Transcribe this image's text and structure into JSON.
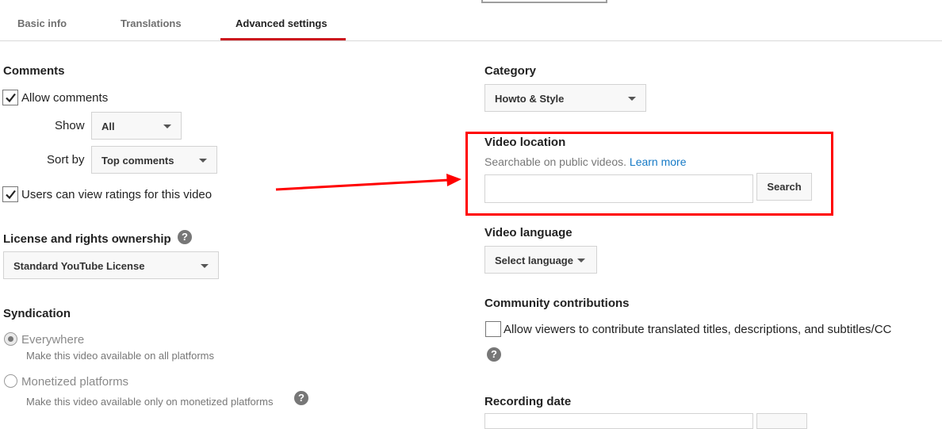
{
  "tabs": [
    "Basic info",
    "Translations",
    "Advanced settings"
  ],
  "comments": {
    "title": "Comments",
    "allow_label": "Allow comments",
    "allow_checked": true,
    "show_label": "Show",
    "show_value": "All",
    "sort_label": "Sort by",
    "sort_value": "Top comments",
    "ratings_label": "Users can view ratings for this video",
    "ratings_checked": true
  },
  "license": {
    "title": "License and rights ownership",
    "value": "Standard YouTube License",
    "help": "?"
  },
  "syndication": {
    "title": "Syndication",
    "options": [
      {
        "label": "Everywhere",
        "desc": "Make this video available on all platforms",
        "selected": true
      },
      {
        "label": "Monetized platforms",
        "desc": "Make this video available only on monetized platforms",
        "selected": false
      }
    ],
    "help": "?"
  },
  "category": {
    "title": "Category",
    "value": "Howto & Style"
  },
  "video_location": {
    "title": "Video location",
    "description": "Searchable on public videos.",
    "learn_more": "Learn more",
    "input_value": "",
    "search_label": "Search"
  },
  "video_language": {
    "title": "Video language",
    "value": "Select language"
  },
  "community": {
    "title": "Community contributions",
    "checkbox_label": "Allow viewers to contribute translated titles, descriptions, and subtitles/CC",
    "checked": false,
    "help": "?"
  },
  "recording_date": {
    "title": "Recording date"
  },
  "colors": {
    "accent_red": "#cc181e",
    "annotation_red": "#ff0000",
    "link_blue": "#167ac6"
  }
}
